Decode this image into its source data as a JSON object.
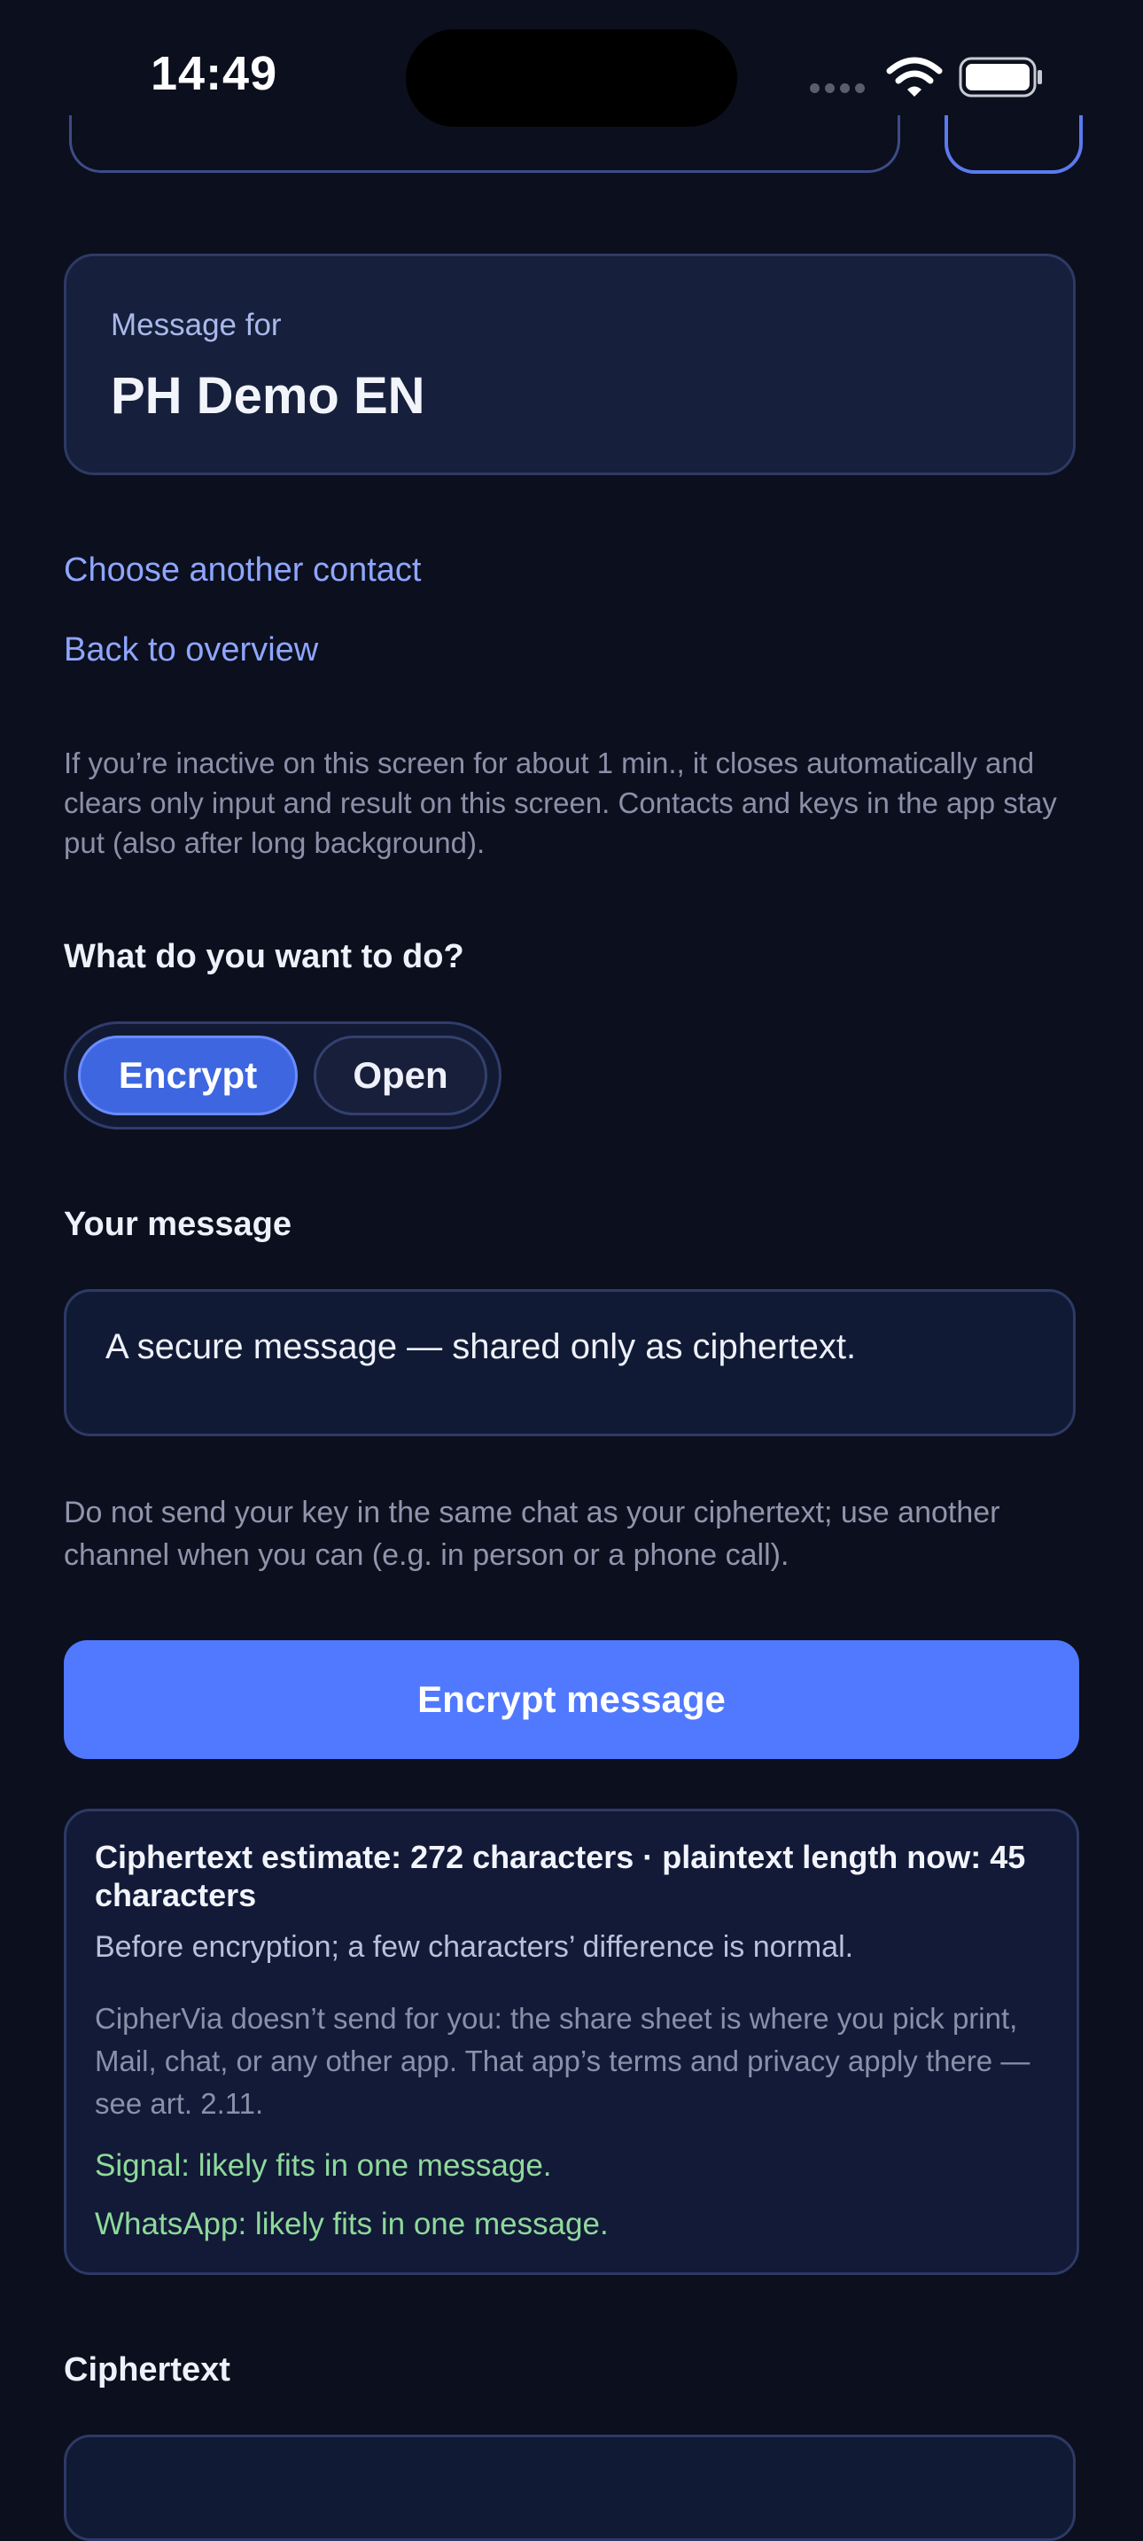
{
  "status_bar": {
    "time": "14:49"
  },
  "recipient": {
    "label": "Message for",
    "name": "PH Demo EN"
  },
  "links": {
    "choose_contact": "Choose another contact",
    "back_overview": "Back to overview"
  },
  "inactivity_hint": "If you’re inactive on this screen for about 1 min., it closes automatically and clears only input and result on this screen. Contacts and keys in the app stay put (also after long background).",
  "mode": {
    "question": "What do you want to do?",
    "options": [
      "Encrypt",
      "Open"
    ],
    "selected": "Encrypt"
  },
  "message": {
    "label": "Your message",
    "value": "A secure message — shared only as ciphertext."
  },
  "key_hint": "Do not send your key in the same chat as your ciphertext; use another channel when you can (e.g. in person or a phone call).",
  "encrypt_button": "Encrypt message",
  "estimate": {
    "title": "Ciphertext estimate: 272 characters · plaintext length now: 45 characters",
    "subtitle": "Before encryption; a few characters’ difference is normal.",
    "note": "CipherVia doesn’t send for you: the share sheet is where you pick print, Mail, chat, or any other app. That app’s terms and privacy apply there — see art. 2.11.",
    "signal": "Signal: likely fits in one message.",
    "whatsapp": "WhatsApp: likely fits in one message."
  },
  "ciphertext": {
    "label": "Ciphertext"
  },
  "colors": {
    "background": "#0c0f1d",
    "accent": "#5079ff",
    "link": "#8ea6ff",
    "success": "#8fd99a"
  }
}
